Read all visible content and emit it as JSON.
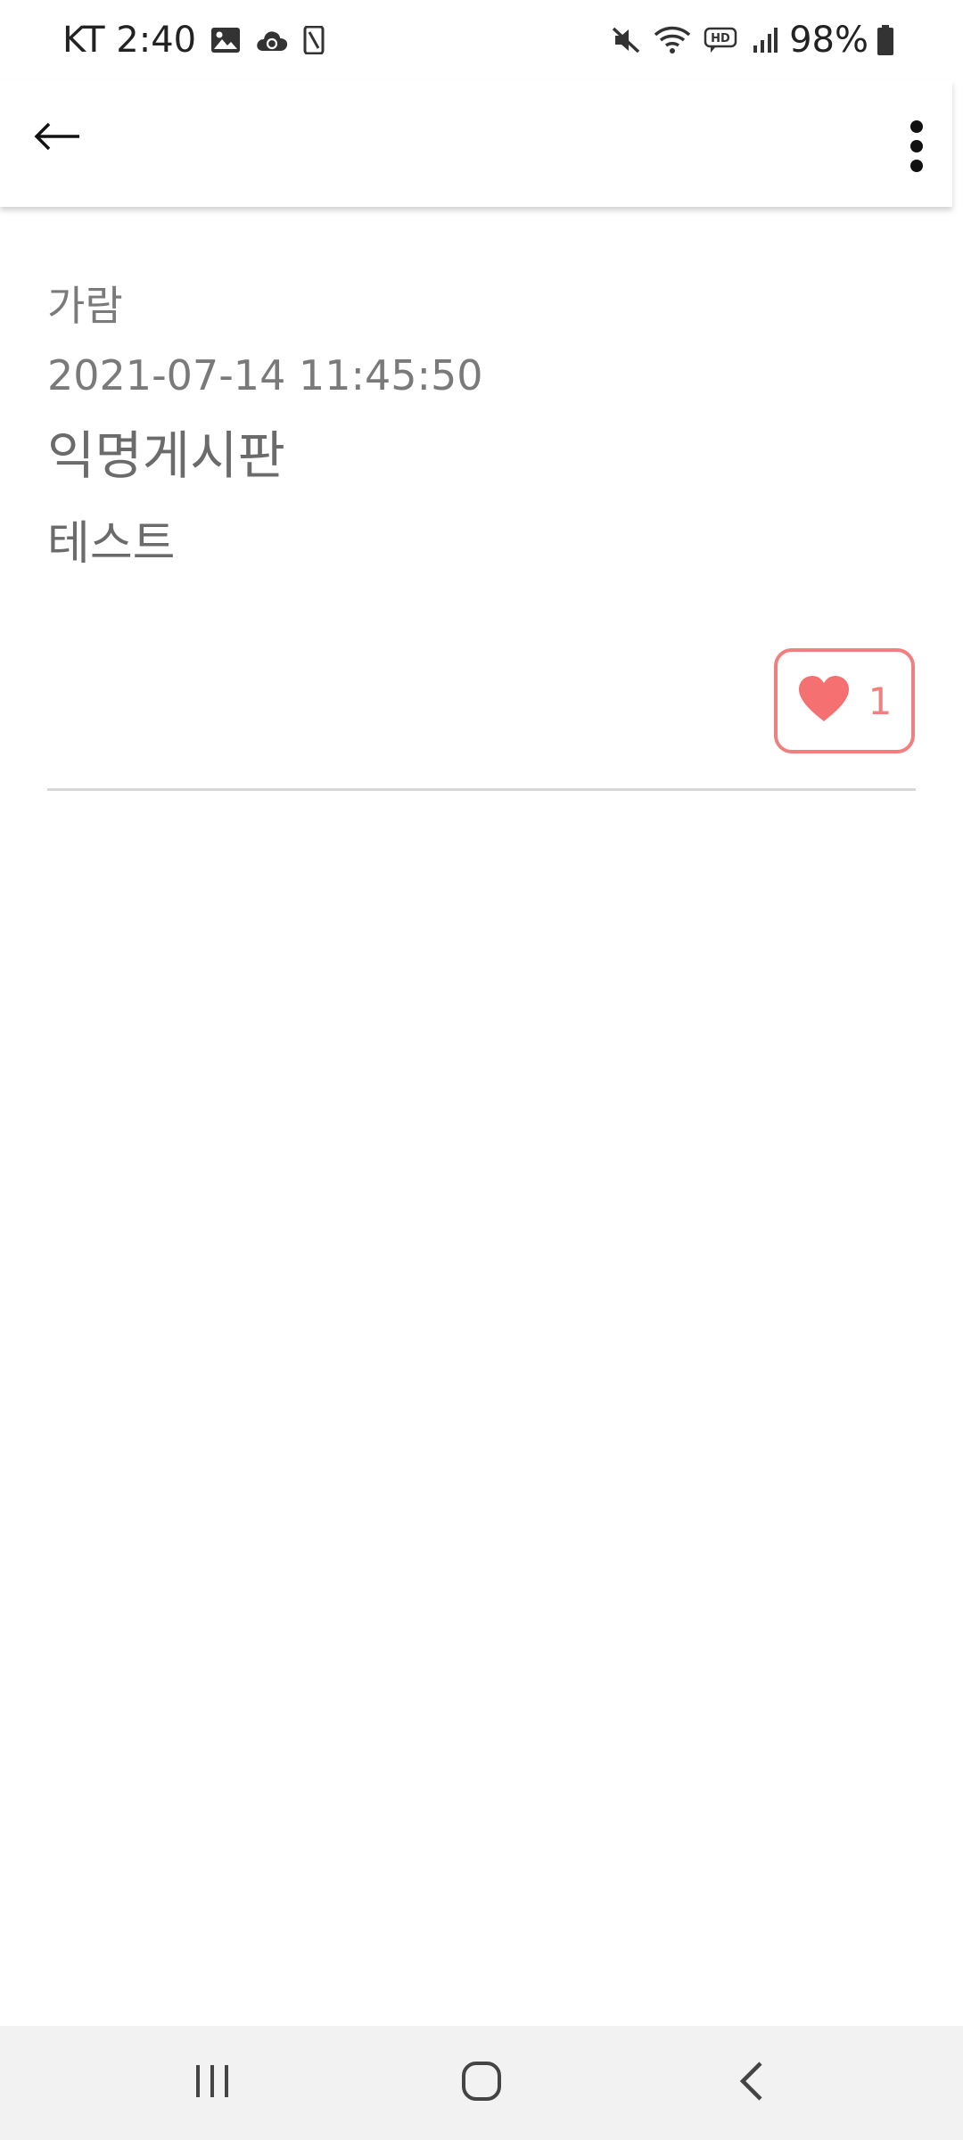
{
  "status_bar": {
    "carrier_time": "KT 2:40",
    "battery_percent": "98%",
    "left_icons": [
      "image-icon",
      "cloud-sync-icon",
      "phone-screen-icon"
    ],
    "right_icons": [
      "mute-icon",
      "wifi-icon",
      "hd-voice-icon",
      "signal-icon",
      "battery-icon"
    ]
  },
  "app_bar": {
    "back_icon": "arrow-left-icon",
    "menu_icon": "more-vertical-icon"
  },
  "post": {
    "author": "가람",
    "date": "2021-07-14 11:45:50",
    "title": "익명게시판",
    "body": "테스트",
    "like_count": "1",
    "like_icon": "heart-icon"
  },
  "colors": {
    "accent": "#f08080",
    "text_secondary": "#7a7a7a",
    "divider": "#d6d6d6",
    "nav_background": "#f2f2f2"
  },
  "nav_bar": {
    "buttons": [
      "recent-apps-icon",
      "home-icon",
      "back-nav-icon"
    ]
  }
}
